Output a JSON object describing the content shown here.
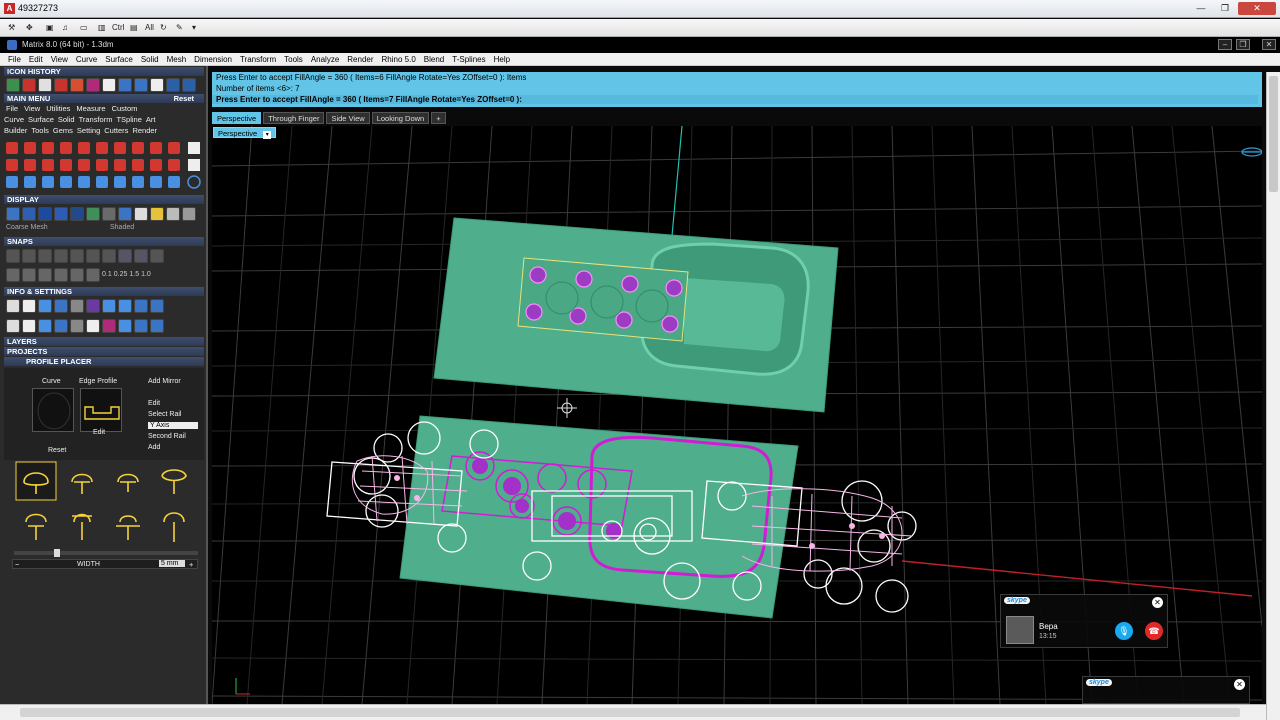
{
  "window": {
    "title": "49327273",
    "minimize": "—",
    "maximize": "❐",
    "close": "✕"
  },
  "quick_toolbar": {
    "ctrl": "Ctrl",
    "all": "All"
  },
  "app": {
    "title": "Matrix 8.0 (64 bit) - 1.3dm"
  },
  "menu": [
    "File",
    "Edit",
    "View",
    "Curve",
    "Surface",
    "Solid",
    "Mesh",
    "Dimension",
    "Transform",
    "Tools",
    "Analyze",
    "Render",
    "Rhino 5.0",
    "Blend",
    "T-Splines",
    "Help"
  ],
  "left_panel": {
    "icon_history": "ICON HISTORY",
    "main_menu": "MAIN MENU",
    "main_menu_reset": "Reset",
    "main_menu_row1": [
      "File",
      "View",
      "Utilities",
      "Measure",
      "Custom"
    ],
    "main_menu_row2": [
      "Curve",
      "Surface",
      "Solid",
      "Transform",
      "TSpline",
      "Art"
    ],
    "main_menu_row3": [
      "Builder",
      "Tools",
      "Gems",
      "Setting",
      "Cutters",
      "Render"
    ],
    "display": "DISPLAY",
    "display_mesh": "Coarse Mesh",
    "display_shade": "Shaded",
    "snaps": "SNAPS",
    "snap_values": [
      "0.1",
      "0.25",
      "1.5",
      "1.0"
    ],
    "info_settings": "INFO & SETTINGS",
    "layers": "LAYERS",
    "projects": "PROJECTS",
    "profile_placer": "PROFILE PLACER",
    "curve": "Curve",
    "edge_profile": "Edge Profile",
    "edit_btn": "Edit",
    "reset_btn": "Reset",
    "options": [
      "Add Mirror",
      "Edit",
      "Select Rail",
      "Y Axis",
      "Second Rail",
      "Add"
    ],
    "width_label": "WIDTH",
    "width_value": "5 mm"
  },
  "command": {
    "line1": "Press Enter to accept  FillAngle = 360 ( Items=6  FillAngle  Rotate=Yes  ZOffset=0 ):  Items",
    "line2": "Number of items <6>: 7",
    "line3": "Press Enter to accept  FillAngle = 360 ( Items=7  FillAngle  Rotate=Yes  ZOffset=0 ):"
  },
  "tabs": [
    "Perspective",
    "Through Finger",
    "Side View",
    "Looking Down",
    "+"
  ],
  "viewport_label": "Perspective",
  "skype_call": {
    "brand": "skype",
    "name": "Вера",
    "time": "13:15"
  },
  "skype_mini": {
    "brand": "skype"
  },
  "colors": {
    "model": "#4fae8c",
    "highlight": "#62c4e6",
    "magenta": "#d21bd6",
    "stone": "#9b3cc2"
  }
}
